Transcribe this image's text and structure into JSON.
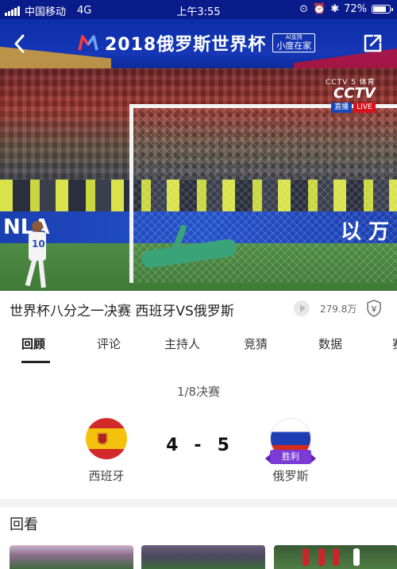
{
  "status_bar": {
    "carrier": "中国移动",
    "network": "4G",
    "time": "上午3:55",
    "battery": "72%",
    "battery_level": 0.72
  },
  "header": {
    "title": "2018俄罗斯世界杯",
    "ai_badge_small": "AI支持",
    "ai_badge_main": "小度在家",
    "icons": [
      "back-arrow-icon",
      "worldcup-logo-icon",
      "share-icon"
    ]
  },
  "video": {
    "ad_left": "NLA",
    "ad_right": "以 万",
    "player_number": "10",
    "broadcaster_line1": "CCTV 5 体育",
    "broadcaster_logo": "CCTV",
    "badge_live_cn": "直播",
    "badge_live_en": "LIVE"
  },
  "match_info": {
    "title": "世界杯八分之一决赛 西班牙VS俄罗斯",
    "views": "279.8万",
    "icons": [
      "play-icon",
      "shield-icon"
    ]
  },
  "tabs": [
    {
      "label": "回顾",
      "active": true
    },
    {
      "label": "评论",
      "active": false
    },
    {
      "label": "主持人",
      "active": false
    },
    {
      "label": "竞猜",
      "active": false
    },
    {
      "label": "数据",
      "active": false
    },
    {
      "label": "赛",
      "active": false
    }
  ],
  "match": {
    "round": "1/8决赛",
    "home": {
      "name": "西班牙",
      "score": "4"
    },
    "away": {
      "name": "俄罗斯",
      "score": "5",
      "badge": "胜利"
    },
    "separator": "-"
  },
  "replay": {
    "title": "回看"
  },
  "colors": {
    "header_blue": "#0b2ea8",
    "win_badge": "#7c3ad6",
    "live_red": "#d8141e"
  }
}
